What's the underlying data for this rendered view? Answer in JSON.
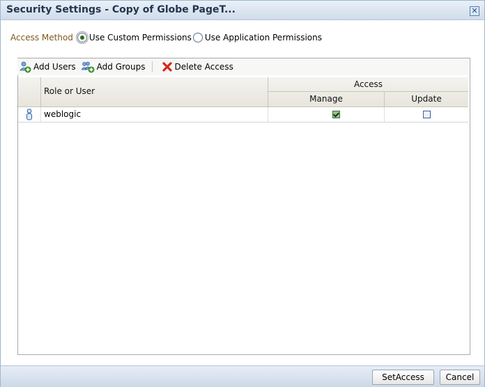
{
  "dialog": {
    "title": "Security Settings - Copy of Globe PageT...",
    "close_icon": "x-close-icon"
  },
  "access_method": {
    "label": "Access Method",
    "options": [
      {
        "label": "Use Custom Permissions",
        "selected": true
      },
      {
        "label": "Use Application Permissions",
        "selected": false
      }
    ]
  },
  "toolbar": {
    "add_users": "Add Users",
    "add_groups": "Add Groups",
    "delete_access": "Delete Access"
  },
  "table": {
    "col_role": "Role or User",
    "col_access": "Access",
    "col_manage": "Manage",
    "col_update": "Update",
    "rows": [
      {
        "name": "weblogic",
        "type_icon": "user-icon",
        "manage": true,
        "update": false
      }
    ]
  },
  "footer": {
    "set_access": "SetAccess",
    "cancel": "Cancel"
  },
  "colors": {
    "title_text": "#24364d",
    "access_label": "#7a5a1c",
    "checked_box": "#9bc08a"
  }
}
